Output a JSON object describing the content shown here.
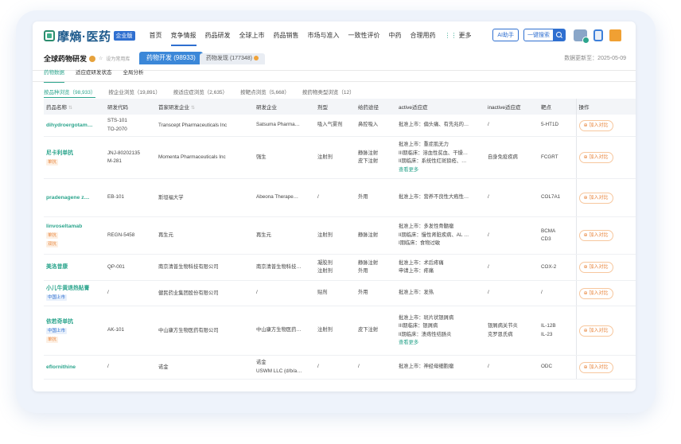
{
  "logo": {
    "text": "摩熵·医药",
    "tag": "企业版"
  },
  "nav": [
    "首页",
    "竞争情报",
    "药品研发",
    "全球上市",
    "药品销售",
    "市场与准入",
    "一致性评价",
    "中药",
    "合理用药"
  ],
  "nav_more": "更多",
  "top_right": {
    "ai": "AI助手",
    "search": "一键搜索"
  },
  "page": {
    "title": "全球药物研发",
    "favorite": "设为常用库",
    "tab_active": "药物开发 (98933)",
    "tab_other": "药物发现 (177348)",
    "update_time": "数据更新至：2025-05-09"
  },
  "sub_tabs": [
    "药物数据",
    "适应症研发状态",
    "全局分析"
  ],
  "filters": [
    "按品种浏览（98,933）",
    "按企业浏览（19,891）",
    "按适应症浏览（2,635）",
    "按靶点浏览（5,668）",
    "按药物类型浏览（12）"
  ],
  "table": {
    "headers": [
      "药品名称",
      "研发代码",
      "首家研发企业",
      "研发企业",
      "剂型",
      "给药途径",
      "active适应症",
      "inactive适应症",
      "靶点",
      "操作"
    ],
    "compare_label": "加入对比",
    "rows": [
      {
        "name": "dihydroergotam…",
        "badges": [],
        "code": [
          "STS-101",
          "TO-2070"
        ],
        "first": "Transcept Pharmaceuticals Inc",
        "dev": "Satsuma Pharma…",
        "form": [
          "吸入气雾剂"
        ],
        "route": [
          "鼻腔吸入"
        ],
        "active": [
          "批准上市：偏头痛、有先兆的…"
        ],
        "more": "",
        "inactive": [
          "/"
        ],
        "target": [
          "5-HT1D"
        ]
      },
      {
        "name": "尼卡利单抗",
        "badges": [
          {
            "t": "单抗",
            "c": "orange"
          }
        ],
        "code": [
          "JNJ-80202135",
          "M-281"
        ],
        "first": "Momenta Pharmaceuticals Inc",
        "dev": "强生",
        "form": [
          "注射剂"
        ],
        "route": [
          "静脉注射",
          "皮下注射"
        ],
        "active": [
          "批准上市：重症肌无力",
          "III期临床：溶血性贫血、干燥…",
          "II期临床：系统性红斑狼疮、…"
        ],
        "more": "查看更多",
        "inactive": [
          "自身免疫疾病"
        ],
        "target": [
          "FCGRT"
        ]
      },
      {
        "name": "pradenagene z…",
        "badges": [],
        "code": [
          "EB-101"
        ],
        "first": "斯坦福大学",
        "dev": "Abeona Therape…",
        "form": [
          "/"
        ],
        "route": [
          "外用"
        ],
        "active": [
          "批准上市：营养不良性大疱性…"
        ],
        "more": "",
        "inactive": [
          "/"
        ],
        "target": [
          "COL7A1"
        ]
      },
      {
        "name": "linvoseltamab",
        "badges": [
          {
            "t": "单抗",
            "c": "orange"
          },
          {
            "t": "双抗",
            "c": "orange"
          }
        ],
        "code": [
          "REGN-5458"
        ],
        "first": "再生元",
        "dev": "再生元",
        "form": [
          "注射剂"
        ],
        "route": [
          "静脉注射"
        ],
        "active": [
          "批准上市：多发性骨髓瘤",
          "II期临床：慢性肾脏疾病、AL …",
          "I期临床：食物过敏"
        ],
        "more": "",
        "inactive": [
          "/"
        ],
        "target": [
          "BCMA",
          "CD3"
        ]
      },
      {
        "name": "美洛昔康",
        "badges": [],
        "code": [
          "QP-001"
        ],
        "first": "南京清普生物科技有限公司",
        "dev": "南京清普生物科技…",
        "form": [
          "凝胶剂",
          "注射剂"
        ],
        "route": [
          "静脉注射",
          "外用"
        ],
        "active": [
          "批准上市：术后疼痛",
          "申请上市：疼痛"
        ],
        "more": "",
        "inactive": [
          "/"
        ],
        "target": [
          "COX-2"
        ]
      },
      {
        "name": "小儿牛黄退热贴膏",
        "badges": [
          {
            "t": "中国上市",
            "c": "blue"
          }
        ],
        "code": [
          "/"
        ],
        "first": "健民药业集团股份有限公司",
        "dev": "/",
        "form": [
          "贴剂"
        ],
        "route": [
          "外用"
        ],
        "active": [
          "批准上市：发热"
        ],
        "more": "",
        "inactive": [
          "/"
        ],
        "target": [
          "/"
        ]
      },
      {
        "name": "依若奇单抗",
        "badges": [
          {
            "t": "中国上市",
            "c": "blue"
          },
          {
            "t": "单抗",
            "c": "orange"
          }
        ],
        "code": [
          "AK-101"
        ],
        "first": "中山康方生物医药有限公司",
        "dev": "中山康方生物医药…",
        "form": [
          "注射剂"
        ],
        "route": [
          "皮下注射"
        ],
        "active": [
          "批准上市：斑片状银屑病",
          "III期临床：银屑病",
          "II期临床：溃疡性结肠炎"
        ],
        "more": "查看更多",
        "inactive": [
          "银屑病关节炎",
          "克罗恩氏病"
        ],
        "target": [
          "IL-12B",
          "IL-23"
        ]
      },
      {
        "name": "eflornithine",
        "badges": [],
        "code": [
          "/"
        ],
        "first": "诺金",
        "dev": "诺金|USWM LLC (d/b/a…",
        "form": [
          "/"
        ],
        "route": [
          "/"
        ],
        "active": [
          "批准上市：神经母细胞瘤"
        ],
        "more": "",
        "inactive": [
          "/"
        ],
        "target": [
          "ODC"
        ]
      }
    ]
  }
}
